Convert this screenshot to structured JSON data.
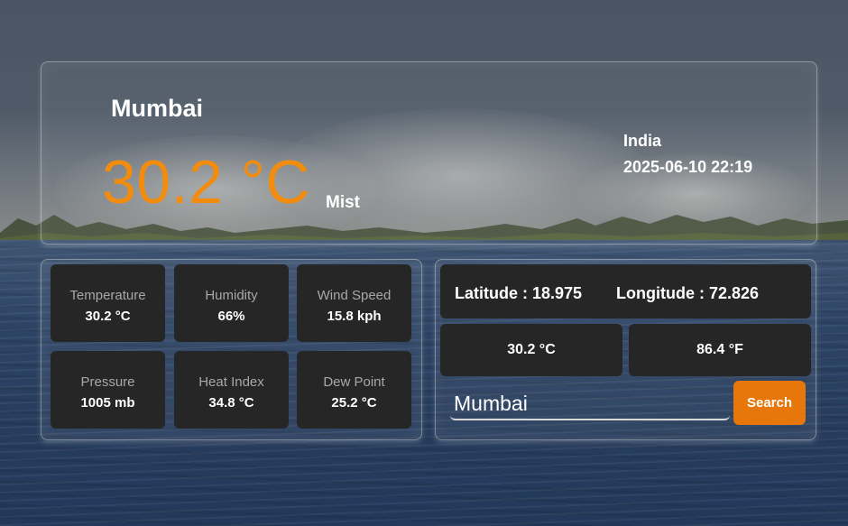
{
  "current": {
    "city": "Mumbai",
    "temperature": "30.2 °C",
    "condition": "Mist",
    "country": "India",
    "datetime": "2025-06-10 22:19"
  },
  "stats": [
    {
      "label": "Temperature",
      "value": "30.2 °C"
    },
    {
      "label": "Humidity",
      "value": "66%"
    },
    {
      "label": "Wind Speed",
      "value": "15.8 kph"
    },
    {
      "label": "Pressure",
      "value": "1005 mb"
    },
    {
      "label": "Heat Index",
      "value": "34.8 °C"
    },
    {
      "label": "Dew Point",
      "value": "25.2 °C"
    }
  ],
  "location": {
    "latitude_text": "Latitude : 18.975",
    "longitude_text": "Longitude : 72.826"
  },
  "units": {
    "celsius": "30.2 °C",
    "fahrenheit": "86.4 °F"
  },
  "search": {
    "value": "Mumbai",
    "button_label": "Search"
  },
  "colors": {
    "accent_temp": "#f28c0f",
    "search_button": "#e8770b",
    "card_bg": "#262626"
  }
}
